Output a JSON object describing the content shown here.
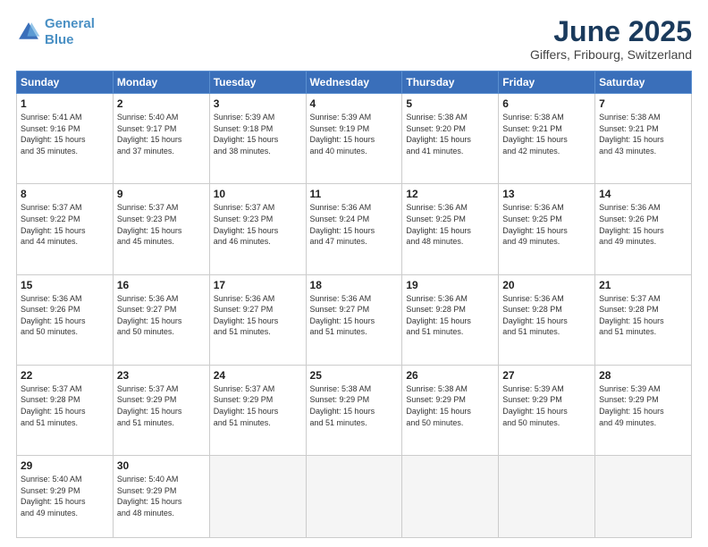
{
  "logo": {
    "line1": "General",
    "line2": "Blue"
  },
  "title": "June 2025",
  "subtitle": "Giffers, Fribourg, Switzerland",
  "headers": [
    "Sunday",
    "Monday",
    "Tuesday",
    "Wednesday",
    "Thursday",
    "Friday",
    "Saturday"
  ],
  "weeks": [
    [
      {
        "day": "1",
        "info": "Sunrise: 5:41 AM\nSunset: 9:16 PM\nDaylight: 15 hours\nand 35 minutes."
      },
      {
        "day": "2",
        "info": "Sunrise: 5:40 AM\nSunset: 9:17 PM\nDaylight: 15 hours\nand 37 minutes."
      },
      {
        "day": "3",
        "info": "Sunrise: 5:39 AM\nSunset: 9:18 PM\nDaylight: 15 hours\nand 38 minutes."
      },
      {
        "day": "4",
        "info": "Sunrise: 5:39 AM\nSunset: 9:19 PM\nDaylight: 15 hours\nand 40 minutes."
      },
      {
        "day": "5",
        "info": "Sunrise: 5:38 AM\nSunset: 9:20 PM\nDaylight: 15 hours\nand 41 minutes."
      },
      {
        "day": "6",
        "info": "Sunrise: 5:38 AM\nSunset: 9:21 PM\nDaylight: 15 hours\nand 42 minutes."
      },
      {
        "day": "7",
        "info": "Sunrise: 5:38 AM\nSunset: 9:21 PM\nDaylight: 15 hours\nand 43 minutes."
      }
    ],
    [
      {
        "day": "8",
        "info": "Sunrise: 5:37 AM\nSunset: 9:22 PM\nDaylight: 15 hours\nand 44 minutes."
      },
      {
        "day": "9",
        "info": "Sunrise: 5:37 AM\nSunset: 9:23 PM\nDaylight: 15 hours\nand 45 minutes."
      },
      {
        "day": "10",
        "info": "Sunrise: 5:37 AM\nSunset: 9:23 PM\nDaylight: 15 hours\nand 46 minutes."
      },
      {
        "day": "11",
        "info": "Sunrise: 5:36 AM\nSunset: 9:24 PM\nDaylight: 15 hours\nand 47 minutes."
      },
      {
        "day": "12",
        "info": "Sunrise: 5:36 AM\nSunset: 9:25 PM\nDaylight: 15 hours\nand 48 minutes."
      },
      {
        "day": "13",
        "info": "Sunrise: 5:36 AM\nSunset: 9:25 PM\nDaylight: 15 hours\nand 49 minutes."
      },
      {
        "day": "14",
        "info": "Sunrise: 5:36 AM\nSunset: 9:26 PM\nDaylight: 15 hours\nand 49 minutes."
      }
    ],
    [
      {
        "day": "15",
        "info": "Sunrise: 5:36 AM\nSunset: 9:26 PM\nDaylight: 15 hours\nand 50 minutes."
      },
      {
        "day": "16",
        "info": "Sunrise: 5:36 AM\nSunset: 9:27 PM\nDaylight: 15 hours\nand 50 minutes."
      },
      {
        "day": "17",
        "info": "Sunrise: 5:36 AM\nSunset: 9:27 PM\nDaylight: 15 hours\nand 51 minutes."
      },
      {
        "day": "18",
        "info": "Sunrise: 5:36 AM\nSunset: 9:27 PM\nDaylight: 15 hours\nand 51 minutes."
      },
      {
        "day": "19",
        "info": "Sunrise: 5:36 AM\nSunset: 9:28 PM\nDaylight: 15 hours\nand 51 minutes."
      },
      {
        "day": "20",
        "info": "Sunrise: 5:36 AM\nSunset: 9:28 PM\nDaylight: 15 hours\nand 51 minutes."
      },
      {
        "day": "21",
        "info": "Sunrise: 5:37 AM\nSunset: 9:28 PM\nDaylight: 15 hours\nand 51 minutes."
      }
    ],
    [
      {
        "day": "22",
        "info": "Sunrise: 5:37 AM\nSunset: 9:28 PM\nDaylight: 15 hours\nand 51 minutes."
      },
      {
        "day": "23",
        "info": "Sunrise: 5:37 AM\nSunset: 9:29 PM\nDaylight: 15 hours\nand 51 minutes."
      },
      {
        "day": "24",
        "info": "Sunrise: 5:37 AM\nSunset: 9:29 PM\nDaylight: 15 hours\nand 51 minutes."
      },
      {
        "day": "25",
        "info": "Sunrise: 5:38 AM\nSunset: 9:29 PM\nDaylight: 15 hours\nand 51 minutes."
      },
      {
        "day": "26",
        "info": "Sunrise: 5:38 AM\nSunset: 9:29 PM\nDaylight: 15 hours\nand 50 minutes."
      },
      {
        "day": "27",
        "info": "Sunrise: 5:39 AM\nSunset: 9:29 PM\nDaylight: 15 hours\nand 50 minutes."
      },
      {
        "day": "28",
        "info": "Sunrise: 5:39 AM\nSunset: 9:29 PM\nDaylight: 15 hours\nand 49 minutes."
      }
    ],
    [
      {
        "day": "29",
        "info": "Sunrise: 5:40 AM\nSunset: 9:29 PM\nDaylight: 15 hours\nand 49 minutes."
      },
      {
        "day": "30",
        "info": "Sunrise: 5:40 AM\nSunset: 9:29 PM\nDaylight: 15 hours\nand 48 minutes."
      },
      {
        "day": "",
        "info": ""
      },
      {
        "day": "",
        "info": ""
      },
      {
        "day": "",
        "info": ""
      },
      {
        "day": "",
        "info": ""
      },
      {
        "day": "",
        "info": ""
      }
    ]
  ]
}
